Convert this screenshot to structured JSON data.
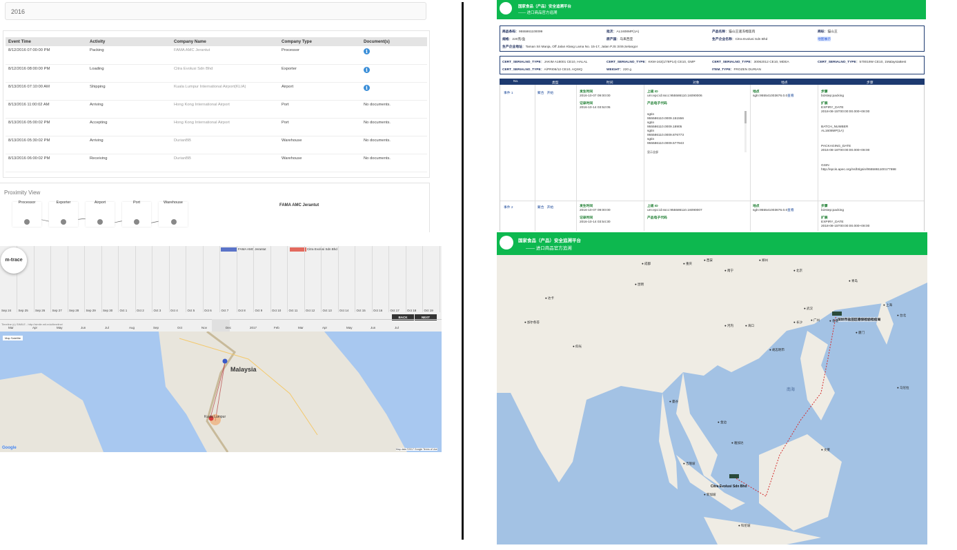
{
  "left_panel": {
    "year": "2016",
    "table": {
      "headers": [
        "Event Time",
        "Activity",
        "Company Name",
        "Company Type",
        "Document(s)"
      ],
      "rows": [
        {
          "time": "8/12/2016 07:00:00 PM",
          "activity": "Packing",
          "company": "FAMA AMC Jerantut",
          "type": "Processor",
          "doc": ""
        },
        {
          "time": "8/12/2016 08:00:00 PM",
          "activity": "Loading",
          "company": "Citra Evolusi Sdn Bhd",
          "type": "Exporter",
          "doc": ""
        },
        {
          "time": "8/13/2016 07:10:00 AM",
          "activity": "Shipping",
          "company": "Kuala Lumpur International Airport(KLIA)",
          "type": "Airport",
          "doc": ""
        },
        {
          "time": "8/13/2016 11:00:02 AM",
          "activity": "Arriving",
          "company": "Hong Kong International Airport",
          "type": "Port",
          "doc": "No documents."
        },
        {
          "time": "8/13/2016 05:00:02 PM",
          "activity": "Accepting",
          "company": "Hong Kong International Airport",
          "type": "Port",
          "doc": "No documents."
        },
        {
          "time": "8/13/2016 05:30:02 PM",
          "activity": "Arriving",
          "company": "DurianBB",
          "type": "Warehouse",
          "doc": "No documents."
        },
        {
          "time": "8/13/2016 06:00:02 PM",
          "activity": "Receiving",
          "company": "DurianBB",
          "type": "Warehouse",
          "doc": "No documents."
        }
      ]
    },
    "proximity": {
      "title": "Proximity View",
      "nodes": [
        "Processor",
        "Exporter",
        "Airport",
        "Port",
        "Warehouse"
      ],
      "selected": "FAMA AMC Jerantut"
    },
    "timeline": {
      "legend": [
        "FAMA AMC Jerantut",
        "Citra Evolusi Sdn Bhd"
      ],
      "days": [
        "Sep 24",
        "Sep 25",
        "Sep 26",
        "Sep 27",
        "Sep 28",
        "Sep 29",
        "Sep 30",
        "Oct 1",
        "Oct 2",
        "Oct 3",
        "Oct 4",
        "Oct 5",
        "Oct 6",
        "Oct 7",
        "Oct 8",
        "Oct 9",
        "Oct 10",
        "Oct 11",
        "Oct 12",
        "Oct 13",
        "Oct 14",
        "Oct 15",
        "Oct 16",
        "Oct 17",
        "Oct 18",
        "Oct 19"
      ],
      "months": [
        "Mar",
        "Apr",
        "May",
        "Jun",
        "Jul",
        "Aug",
        "Sep",
        "Oct",
        "Nov",
        "Dec",
        "2017",
        "Feb",
        "Mar",
        "Apr",
        "May",
        "Jun",
        "Jul"
      ],
      "back": "BACK",
      "next": "NEXT",
      "logo": "m-trace",
      "credit": "Timeline (c) SIMILE - http://simile.mit.edu/timeline/"
    },
    "map": {
      "toggle": "Map   Satellite",
      "country": "Malaysia",
      "city": "Kuala Lumpur",
      "google": "Google",
      "attrib": "Map data ©2017 Google    Terms of Use"
    }
  },
  "right_panel": {
    "header_title": "国家食品（产品）安全追溯平台",
    "header_sub": "—— 进口商品官方追溯",
    "info": {
      "row1": [
        [
          "商品条码",
          "9555861100099"
        ],
        [
          "批次",
          "AL1608MP(1A)"
        ],
        [
          "产品名称",
          "猫山王速冻榴莲肉"
        ],
        [
          "商标",
          "猫山王"
        ]
      ],
      "row2": [
        [
          "规格",
          "220克/盒"
        ],
        [
          "原产国",
          "马来西亚"
        ],
        [
          "生产企业名称",
          "Citra Evolusi Sdn Bhd"
        ],
        [
          "",
          "地图展示"
        ]
      ],
      "address_label": "生产企业地址",
      "address": "Taman Sri Manja, Off Jalan Klang Lama No. 15-17, Jalan PJS 3/49,Selangor"
    },
    "certs": {
      "row1": [
        [
          "CERT_SERIALNO_TYPE",
          "JAKIM A18001 CE10, HALAL"
        ],
        [
          "CERT_SERIALNO_TYPE",
          "KKM-163(1/78P14) CE10, GMP"
        ],
        [
          "CERT_SERIALNO_TYPE",
          "30062012 CE10, MDEA"
        ],
        [
          "CERT_SERIALNO_TYPE",
          "570019W CE10, 1MalaysiaBest"
        ]
      ],
      "row2": [
        [
          "CERT_SERIALNO_TYPE",
          "A/PRI06/12 CE10, AQSIQ"
        ],
        [
          "WEIGHT",
          "220 g"
        ],
        [
          "ITEM_TYPE",
          "FROZEN DURIAN"
        ]
      ]
    },
    "grid_headers": [
      "No.",
      "类型",
      "时间",
      "对象",
      "地点",
      "步骤"
    ],
    "events": [
      {
        "no": "事件 1",
        "type": "聚合",
        "type2": "开始",
        "occur_label": "发生时间",
        "occur": "2016-10-07 09:00:00",
        "record_label": "记录时间",
        "record": "2016-10-14 03:52:05",
        "parent_label": "上级 ID",
        "parent": "urn:epc:id:sscc:955586110.16090006",
        "code_label": "产品电子代码",
        "codes": [
          "sgtin",
          "955586110.0009.151556",
          "sgtin",
          "955586110.0009.18905",
          "sgtin",
          "955586110.0009.876773",
          "sgtin",
          "955586110.0009.577943"
        ],
        "more": "显示全部",
        "loc_label": "地点",
        "loc": "sgln:955541003676.0.0",
        "loc_link": "查看",
        "step_label": "步骤",
        "step": "bizstep:packing",
        "ext_label": "扩展",
        "ext": [
          "EXPIRY_DATE",
          "2018-08-15T00:00:00.000+08:00",
          "BATCH_NUMBER",
          "AL1608MP(1A)",
          "PACKAGING_DATE",
          "2016-08-16T00:00:00.000+08:00",
          "GSIN",
          "http://epcis.apec.org/ns/bt/gsin/9555861100177698"
        ]
      },
      {
        "no": "事件 2",
        "type": "聚合",
        "type2": "开始",
        "occur_label": "发生时间",
        "occur": "2016-10-07 09:00:00",
        "record_label": "记录时间",
        "record": "2016-10-14 03:54:30",
        "parent_label": "上级 ID",
        "parent": "urn:epc:id:sscc:955586110.16090007",
        "code_label": "产品电子代码",
        "loc_label": "地点",
        "loc": "sgln:955541003676.0.0",
        "loc_link": "查看",
        "step_label": "步骤",
        "step": "bizstep:packing",
        "ext_label": "扩展",
        "ext": [
          "EXPIRY_DATE",
          "2018-08-15T00:00:00.000+08:00"
        ]
      }
    ],
    "map": {
      "header_title": "国家食品（产品）安全追溯平台",
      "header_sub": "—— 进口商品官方追溯",
      "dest": "深圳市盐田区德保检验检疫局",
      "origin": "Citra Evolusi Sdn Bhd",
      "sea": "南海",
      "cities": [
        "北京",
        "青岛",
        "上海",
        "武汉",
        "长沙",
        "广州",
        "香港",
        "台北",
        "厦门",
        "河内",
        "曼谷",
        "金边",
        "吉隆坡",
        "新加坡",
        "马尼拉",
        "达卡",
        "加尔各答",
        "仰光",
        "昆明",
        "成都",
        "重庆",
        "南宁",
        "海口",
        "胡志明市",
        "雅加达",
        "科伦坡",
        "文莱",
        "西安",
        "郑州"
      ]
    }
  }
}
